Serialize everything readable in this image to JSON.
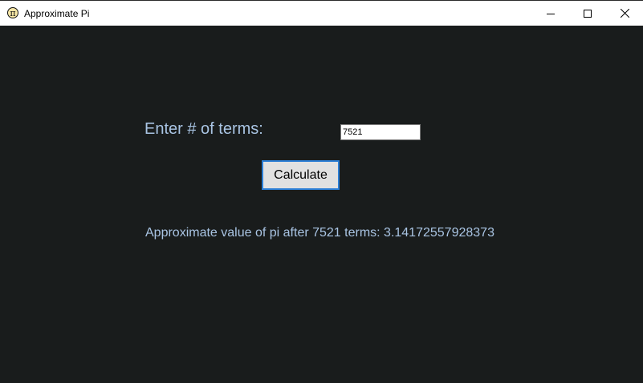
{
  "window": {
    "title": "Approximate Pi",
    "app_icon_glyph": "π",
    "controls": {
      "minimize_icon": "minimize-icon",
      "maximize_icon": "maximize-icon",
      "close_icon": "close-icon"
    }
  },
  "form": {
    "prompt_label": "Enter # of terms:",
    "terms_value": "7521",
    "calculate_label": "Calculate"
  },
  "result": {
    "text": "Approximate value of pi after 7521 terms: 3.14172557928373"
  },
  "colors": {
    "background": "#191c1c",
    "label_text": "#a9c4e3",
    "button_focus_border": "#2c7fd6"
  }
}
